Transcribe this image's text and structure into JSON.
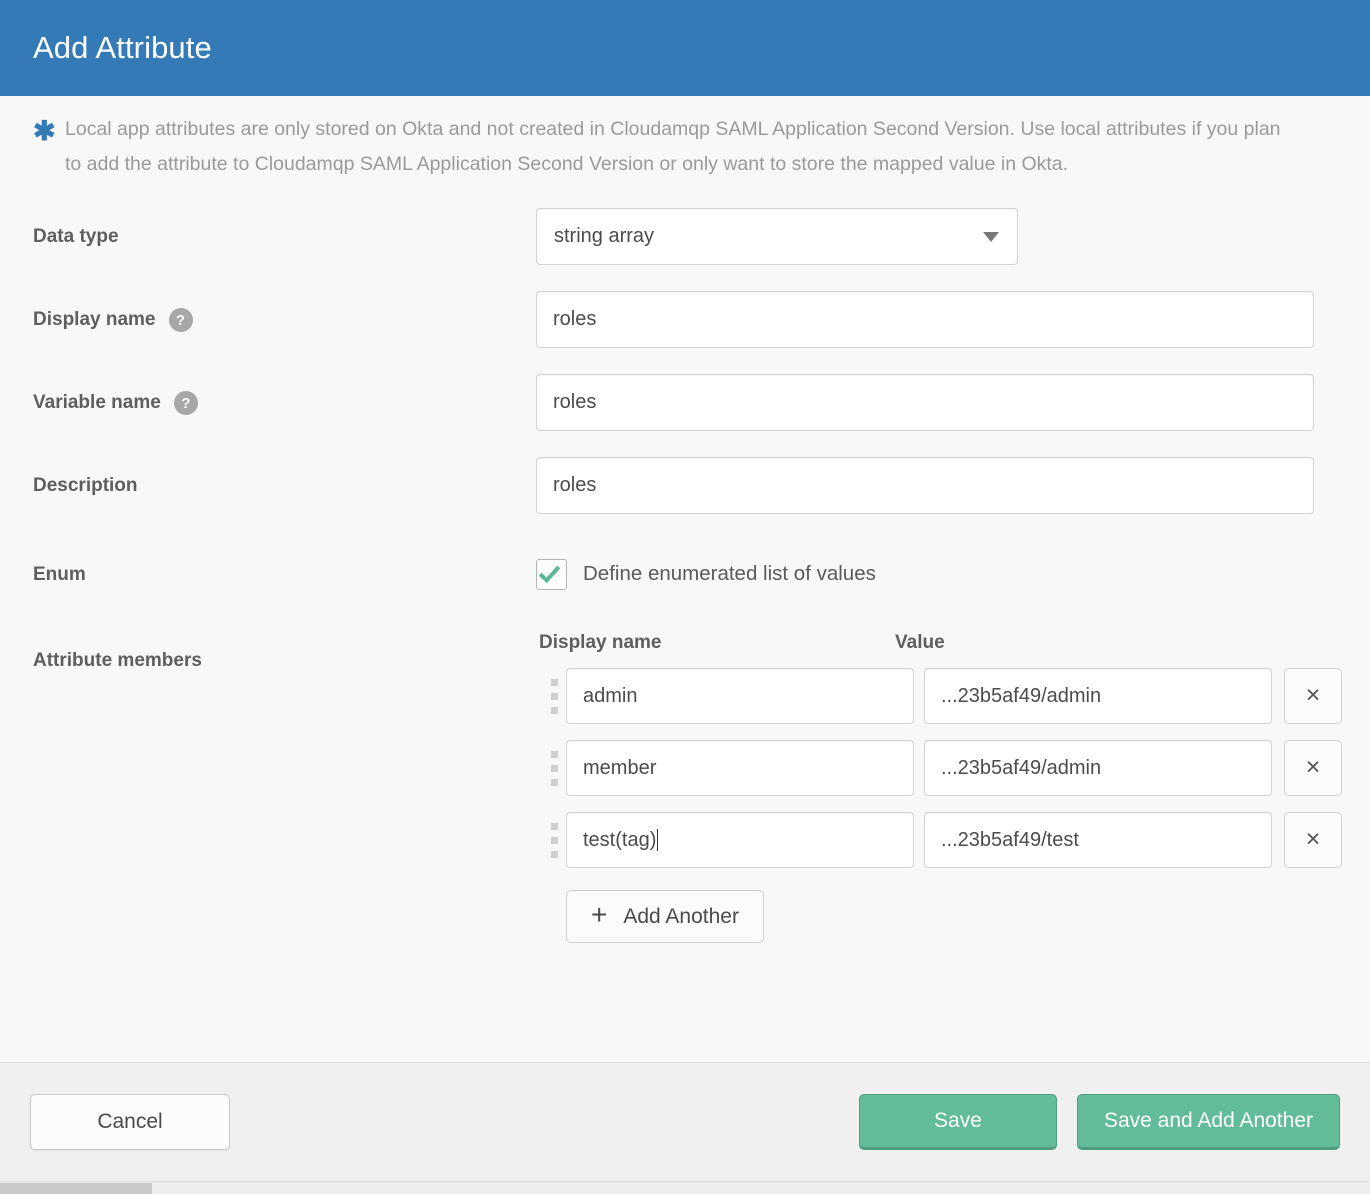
{
  "dialog": {
    "title": "Add Attribute",
    "header_color": "#337ab7",
    "notice": {
      "icon": "asterisk-icon",
      "text": "Local app attributes are only stored on Okta and not created in Cloudamqp SAML Application Second Version. Use local attributes if you plan to add the attribute to Cloudamqp SAML Application Second Version or only want to store the mapped value in Okta."
    }
  },
  "form": {
    "data_type": {
      "label": "Data type",
      "value": "string array"
    },
    "display_name": {
      "label": "Display name",
      "value": "roles",
      "help": "?"
    },
    "variable_name": {
      "label": "Variable name",
      "value": "roles",
      "help": "?"
    },
    "description": {
      "label": "Description",
      "value": "roles"
    },
    "enum": {
      "label": "Enum",
      "checkbox_label": "Define enumerated list of values",
      "checked": true,
      "check_color": "#5cb894"
    },
    "attribute_members": {
      "label": "Attribute members",
      "columns": {
        "display_name": "Display name",
        "value": "Value"
      },
      "rows": [
        {
          "display_name": "admin",
          "value": "...23b5af49/admin",
          "remove": "×"
        },
        {
          "display_name": "member",
          "value": "...23b5af49/admin",
          "remove": "×"
        },
        {
          "display_name": "test(tag)",
          "value": "...23b5af49/test",
          "remove": "×",
          "focused": true
        }
      ],
      "add_another_label": "Add Another",
      "add_another_plus": "+"
    }
  },
  "footer": {
    "cancel_label": "Cancel",
    "save_label": "Save",
    "save_add_label": "Save and Add Another",
    "save_color": "#62bc9a"
  }
}
